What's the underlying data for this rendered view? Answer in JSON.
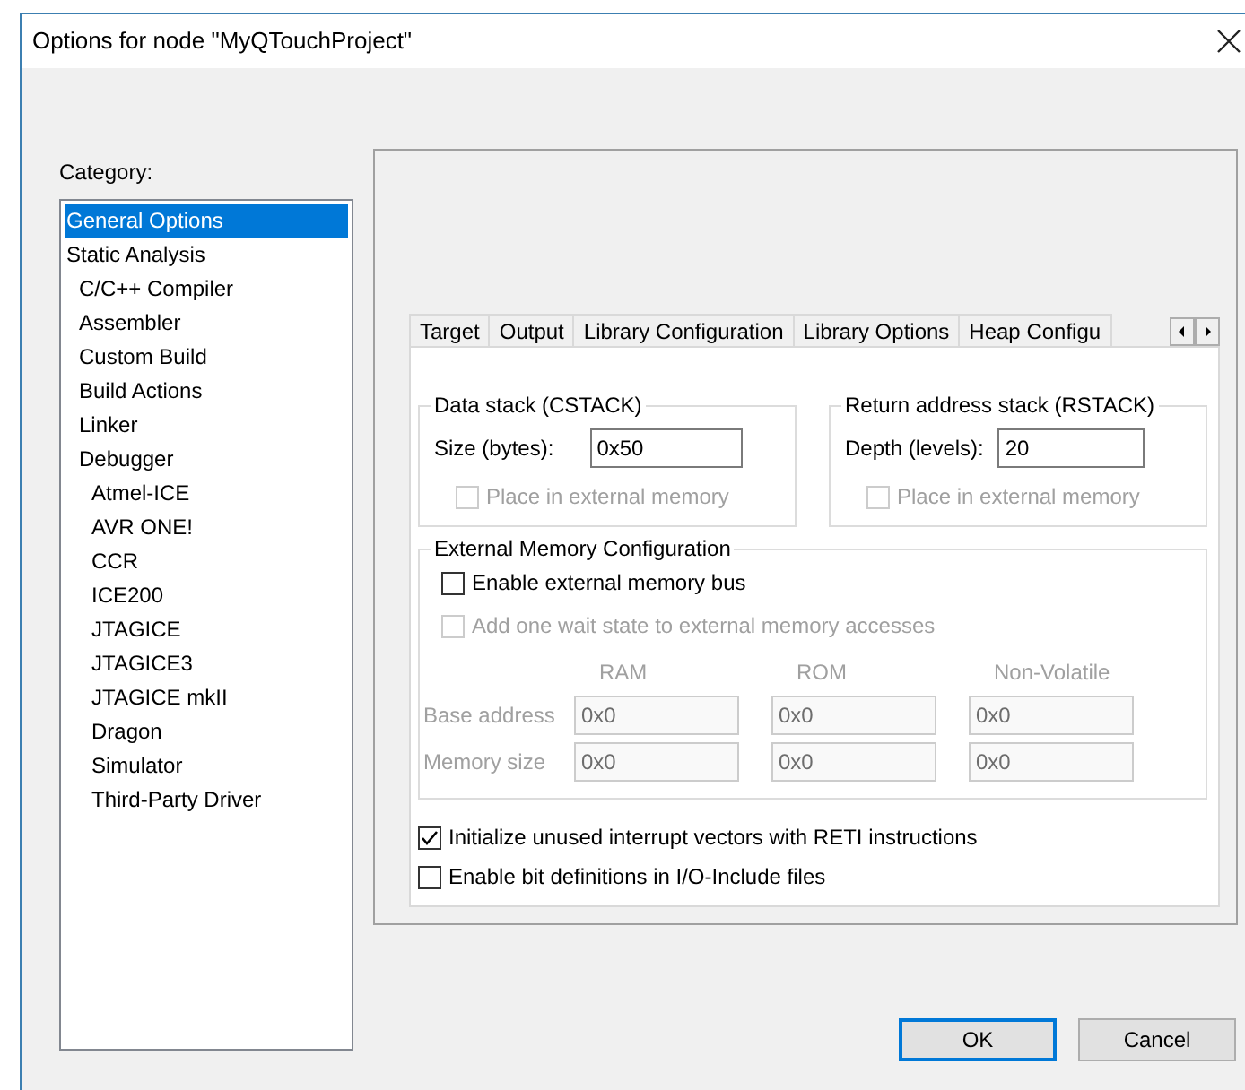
{
  "window": {
    "title": "Options for node \"MyQTouchProject\""
  },
  "category": {
    "label": "Category:",
    "items": [
      {
        "label": "General Options",
        "selected": true
      },
      {
        "label": "Static Analysis",
        "selected": false,
        "children": [
          {
            "label": "C/C++ Compiler",
            "selected": false
          },
          {
            "label": "Assembler",
            "selected": false
          },
          {
            "label": "Custom Build",
            "selected": false
          },
          {
            "label": "Build Actions",
            "selected": false
          },
          {
            "label": "Linker",
            "selected": false
          },
          {
            "label": "Debugger",
            "selected": false,
            "children": [
              {
                "label": "Atmel-ICE",
                "selected": false
              },
              {
                "label": "AVR ONE!",
                "selected": false
              },
              {
                "label": "CCR",
                "selected": false
              },
              {
                "label": "ICE200",
                "selected": false
              },
              {
                "label": "JTAGICE",
                "selected": false
              },
              {
                "label": "JTAGICE3",
                "selected": false
              },
              {
                "label": "JTAGICE mkII",
                "selected": false
              },
              {
                "label": "Dragon",
                "selected": false
              },
              {
                "label": "Simulator",
                "selected": false
              },
              {
                "label": "Third-Party Driver",
                "selected": false
              }
            ]
          }
        ]
      }
    ]
  },
  "tabs": [
    {
      "label": "Target",
      "selected": false
    },
    {
      "label": "Output",
      "selected": false
    },
    {
      "label": "Library Configuration",
      "selected": false
    },
    {
      "label": "Library Options",
      "selected": false
    },
    {
      "label": "Heap Configu",
      "selected": false
    }
  ],
  "stack_groups": [
    {
      "title": "Data stack (CSTACK)",
      "field_label": "Size (bytes):",
      "value": "0x50",
      "option": {
        "label": "Place in external memory",
        "checked": false,
        "disabled": true
      }
    },
    {
      "title": "Return address stack (RSTACK)",
      "field_label": "Depth (levels):",
      "value": "20",
      "option": {
        "label": "Place in external memory",
        "checked": false,
        "disabled": true
      }
    }
  ],
  "external_memory": {
    "title": "External Memory Configuration",
    "options": [
      {
        "label": "Enable external memory bus",
        "checked": false,
        "disabled": false
      },
      {
        "label": "Add one wait state to external memory accesses",
        "checked": false,
        "disabled": true
      }
    ],
    "disabled": true,
    "columns": [
      "RAM",
      "ROM",
      "Non-Volatile"
    ],
    "rows": [
      {
        "label": "Base address",
        "values": [
          "0x0",
          "0x0",
          "0x0"
        ]
      },
      {
        "label": "Memory size",
        "values": [
          "0x0",
          "0x0",
          "0x0"
        ]
      }
    ]
  },
  "options": [
    {
      "label": "Initialize unused interrupt vectors with RETI instructions",
      "checked": true
    },
    {
      "label": "Enable bit definitions in I/O-Include files",
      "checked": false
    }
  ],
  "buttons": [
    {
      "label": "OK",
      "default": true
    },
    {
      "label": "Cancel",
      "default": false
    }
  ]
}
